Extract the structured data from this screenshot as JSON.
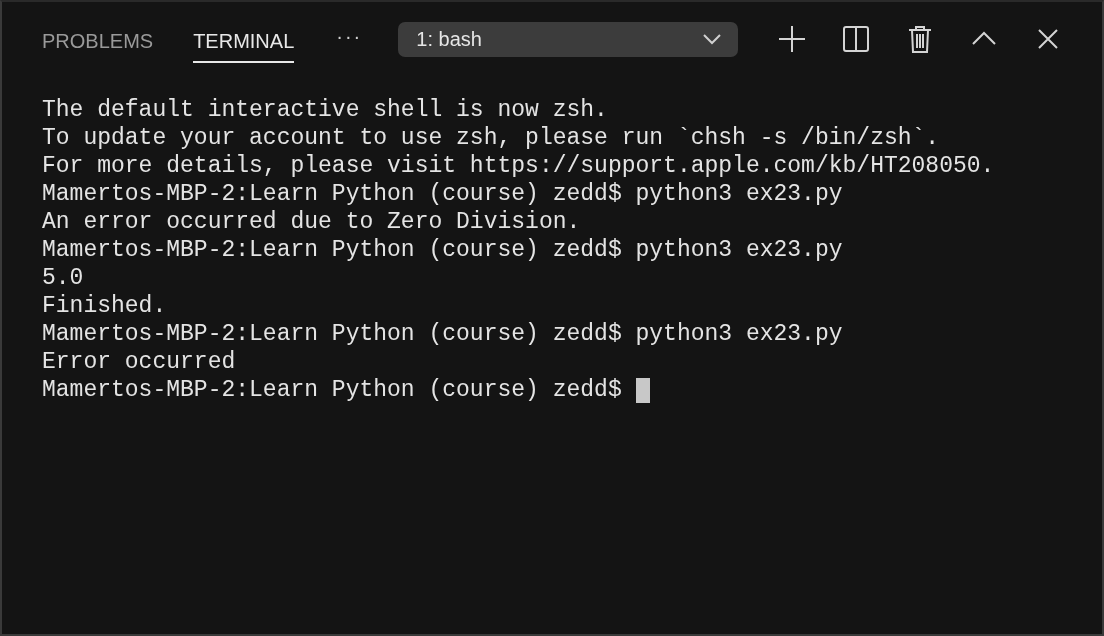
{
  "panel_tabs": [
    {
      "label": "PROBLEMS",
      "selected": false
    },
    {
      "label": "TERMINAL",
      "selected": true
    }
  ],
  "more_actions": "···",
  "terminal_selector": {
    "value": "1: bash"
  },
  "terminal": {
    "lines": [
      "The default interactive shell is now zsh.",
      "To update your account to use zsh, please run `chsh -s /bin/zsh`.",
      "For more details, please visit https://support.apple.com/kb/HT208050.",
      "Mamertos-MBP-2:Learn Python (course) zedd$ python3 ex23.py",
      "An error occurred due to Zero Division.",
      "Mamertos-MBP-2:Learn Python (course) zedd$ python3 ex23.py",
      "5.0",
      "Finished.",
      "Mamertos-MBP-2:Learn Python (course) zedd$ python3 ex23.py",
      "Error occurred",
      "Mamertos-MBP-2:Learn Python (course) zedd$ "
    ],
    "cursor": true
  }
}
